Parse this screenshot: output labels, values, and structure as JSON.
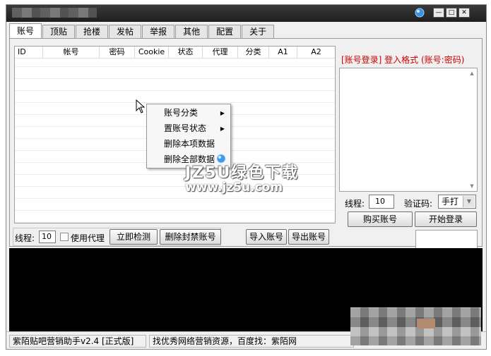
{
  "tabs": [
    "账号",
    "顶贴",
    "抢楼",
    "发帖",
    "举报",
    "其他",
    "配置",
    "关于"
  ],
  "active_tab": 0,
  "table": {
    "columns": [
      "ID",
      "帐号",
      "密码",
      "Cookie",
      "状态",
      "代理",
      "分类",
      "A1",
      "A2"
    ]
  },
  "left_controls": {
    "thread_label": "线程:",
    "thread_value": "10",
    "proxy_label": "使用代理",
    "check_button": "立即检测",
    "delete_banned_button": "删除封禁账号",
    "import_button": "导入账号",
    "export_button": "导出账号"
  },
  "right_panel": {
    "title": "[账号登录] 登入格式 (账号:密码)",
    "thread_label": "线程:",
    "thread_value": "10",
    "captcha_label": "验证码:",
    "captcha_value": "手打",
    "buy_button": "购买账号",
    "start_button": "开始登录"
  },
  "context_menu": {
    "items": [
      {
        "label": "账号分类",
        "submenu": true
      },
      {
        "label": "置账号状态",
        "submenu": true
      },
      {
        "label": "删除本项数据",
        "submenu": false
      },
      {
        "label": "删除全部数据",
        "submenu": false
      }
    ]
  },
  "watermark": {
    "line1": "JZ5U绿色下载",
    "line2": "www.jz5u.com"
  },
  "status_bar": {
    "app_name": "紫陌贴吧营销助手v2.4 [正式版]",
    "message": "找优秀网络营销资源，百度找：紫陌网"
  },
  "colors": {
    "title_text_red": "#cc0000",
    "console_bg": "#000000"
  }
}
